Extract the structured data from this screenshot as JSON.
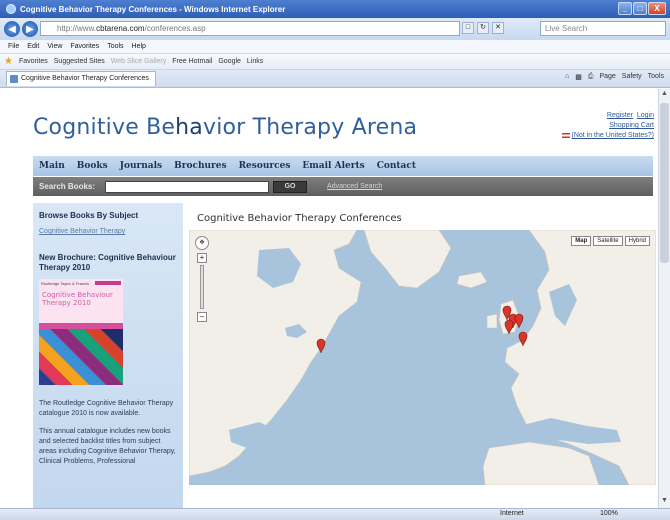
{
  "browser": {
    "window_title": "Cognitive Behavior Therapy Conferences - Windows Internet Explorer",
    "window_buttons": [
      "_",
      "□",
      "X"
    ],
    "url_prefix": "http://www.",
    "url_domain": "cbtarena.com",
    "url_suffix": "/conferences.asp",
    "search_engine_placeholder": "Live Search",
    "menu": [
      "File",
      "Edit",
      "View",
      "Favorites",
      "Tools",
      "Help"
    ],
    "favorites_label": "Favorites",
    "favorites_links": [
      "Suggested Sites",
      "Web Slice Gallery",
      "Free Hotmail",
      "Google",
      "Links"
    ],
    "tab_title": "Cognitive Behavior Therapy Conferences",
    "command_bar": [
      "Page",
      "Safety",
      "Tools"
    ],
    "status_zone": "Internet",
    "status_zoom": "100%"
  },
  "site": {
    "title_part1": "Cognitive Be",
    "title_part2": "ha",
    "title_part3": "vior Therapy Arena",
    "register_label": "Register",
    "login_label": "Login",
    "cart_label": "Shopping Cart",
    "region_text": "(Not in the United States?)",
    "nav": [
      "Main",
      "Books",
      "Journals",
      "Brochures",
      "Resources",
      "Email Alerts",
      "Contact"
    ],
    "search_label": "Search Books:",
    "search_value": "",
    "search_go": "GO",
    "advanced_search": "Advanced Search"
  },
  "sidebar": {
    "browse_heading": "Browse Books By Subject",
    "subject_link": "Cognitive Behavior Therapy",
    "brochure_heading": "New Brochure: Cognitive Behaviour Therapy 2010",
    "brochure_tag": "Routledge Taylor & Francis",
    "brochure_title": "Cognitive Behaviour Therapy 2010",
    "text1": "The Routledge Cognitive Behavior Therapy catalogue 2010 is now available.",
    "text2": "This annual catalogue includes new books and selected backlist titles from subject areas including Cognitive Behavior Therapy, Clinical Problems, Professional"
  },
  "map": {
    "title": "Cognitive Behavior Therapy Conferences",
    "type_buttons": [
      "Map",
      "Satellite",
      "Hybrid"
    ],
    "selected_type": "Map",
    "land_color": "#f2efe8",
    "water_color": "#a8c4dd",
    "marker_color": "#d9362b",
    "marker_count": 6
  }
}
